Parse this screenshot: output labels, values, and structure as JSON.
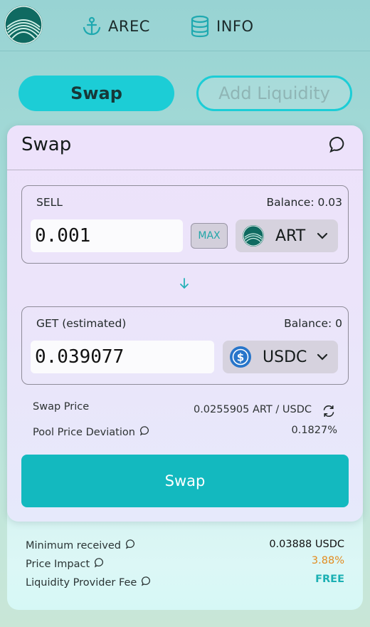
{
  "nav": {
    "arec_label": "AREC",
    "info_label": "INFO"
  },
  "tabs": {
    "swap_label": "Swap",
    "liquidity_label": "Add Liquidity"
  },
  "card": {
    "title": "Swap",
    "sell": {
      "label": "SELL",
      "balance": "Balance: 0.03",
      "amount": "0.001",
      "max_label": "MAX",
      "token": "ART",
      "token_icon": "art-token-icon"
    },
    "get": {
      "label": "GET (estimated)",
      "balance": "Balance: 0",
      "amount": "0.039077",
      "token": "USDC",
      "token_icon": "usdc-token-icon"
    },
    "swap_price_label": "Swap Price",
    "swap_price_value": "0.0255905 ART / USDC",
    "deviation_label": "Pool Price Deviation",
    "deviation_value": "0.1827%",
    "swap_button": "Swap"
  },
  "summary": {
    "min_received_label": "Minimum received",
    "min_received_value": "0.03888 USDC",
    "price_impact_label": "Price Impact",
    "price_impact_value": "3.88%",
    "lp_fee_label": "Liquidity Provider Fee",
    "lp_fee_value": "FREE"
  },
  "colors": {
    "accent": "#1ccdd6",
    "button": "#13b9bf",
    "price_impact": "#e28a1e",
    "free": "#1bb0b3"
  }
}
